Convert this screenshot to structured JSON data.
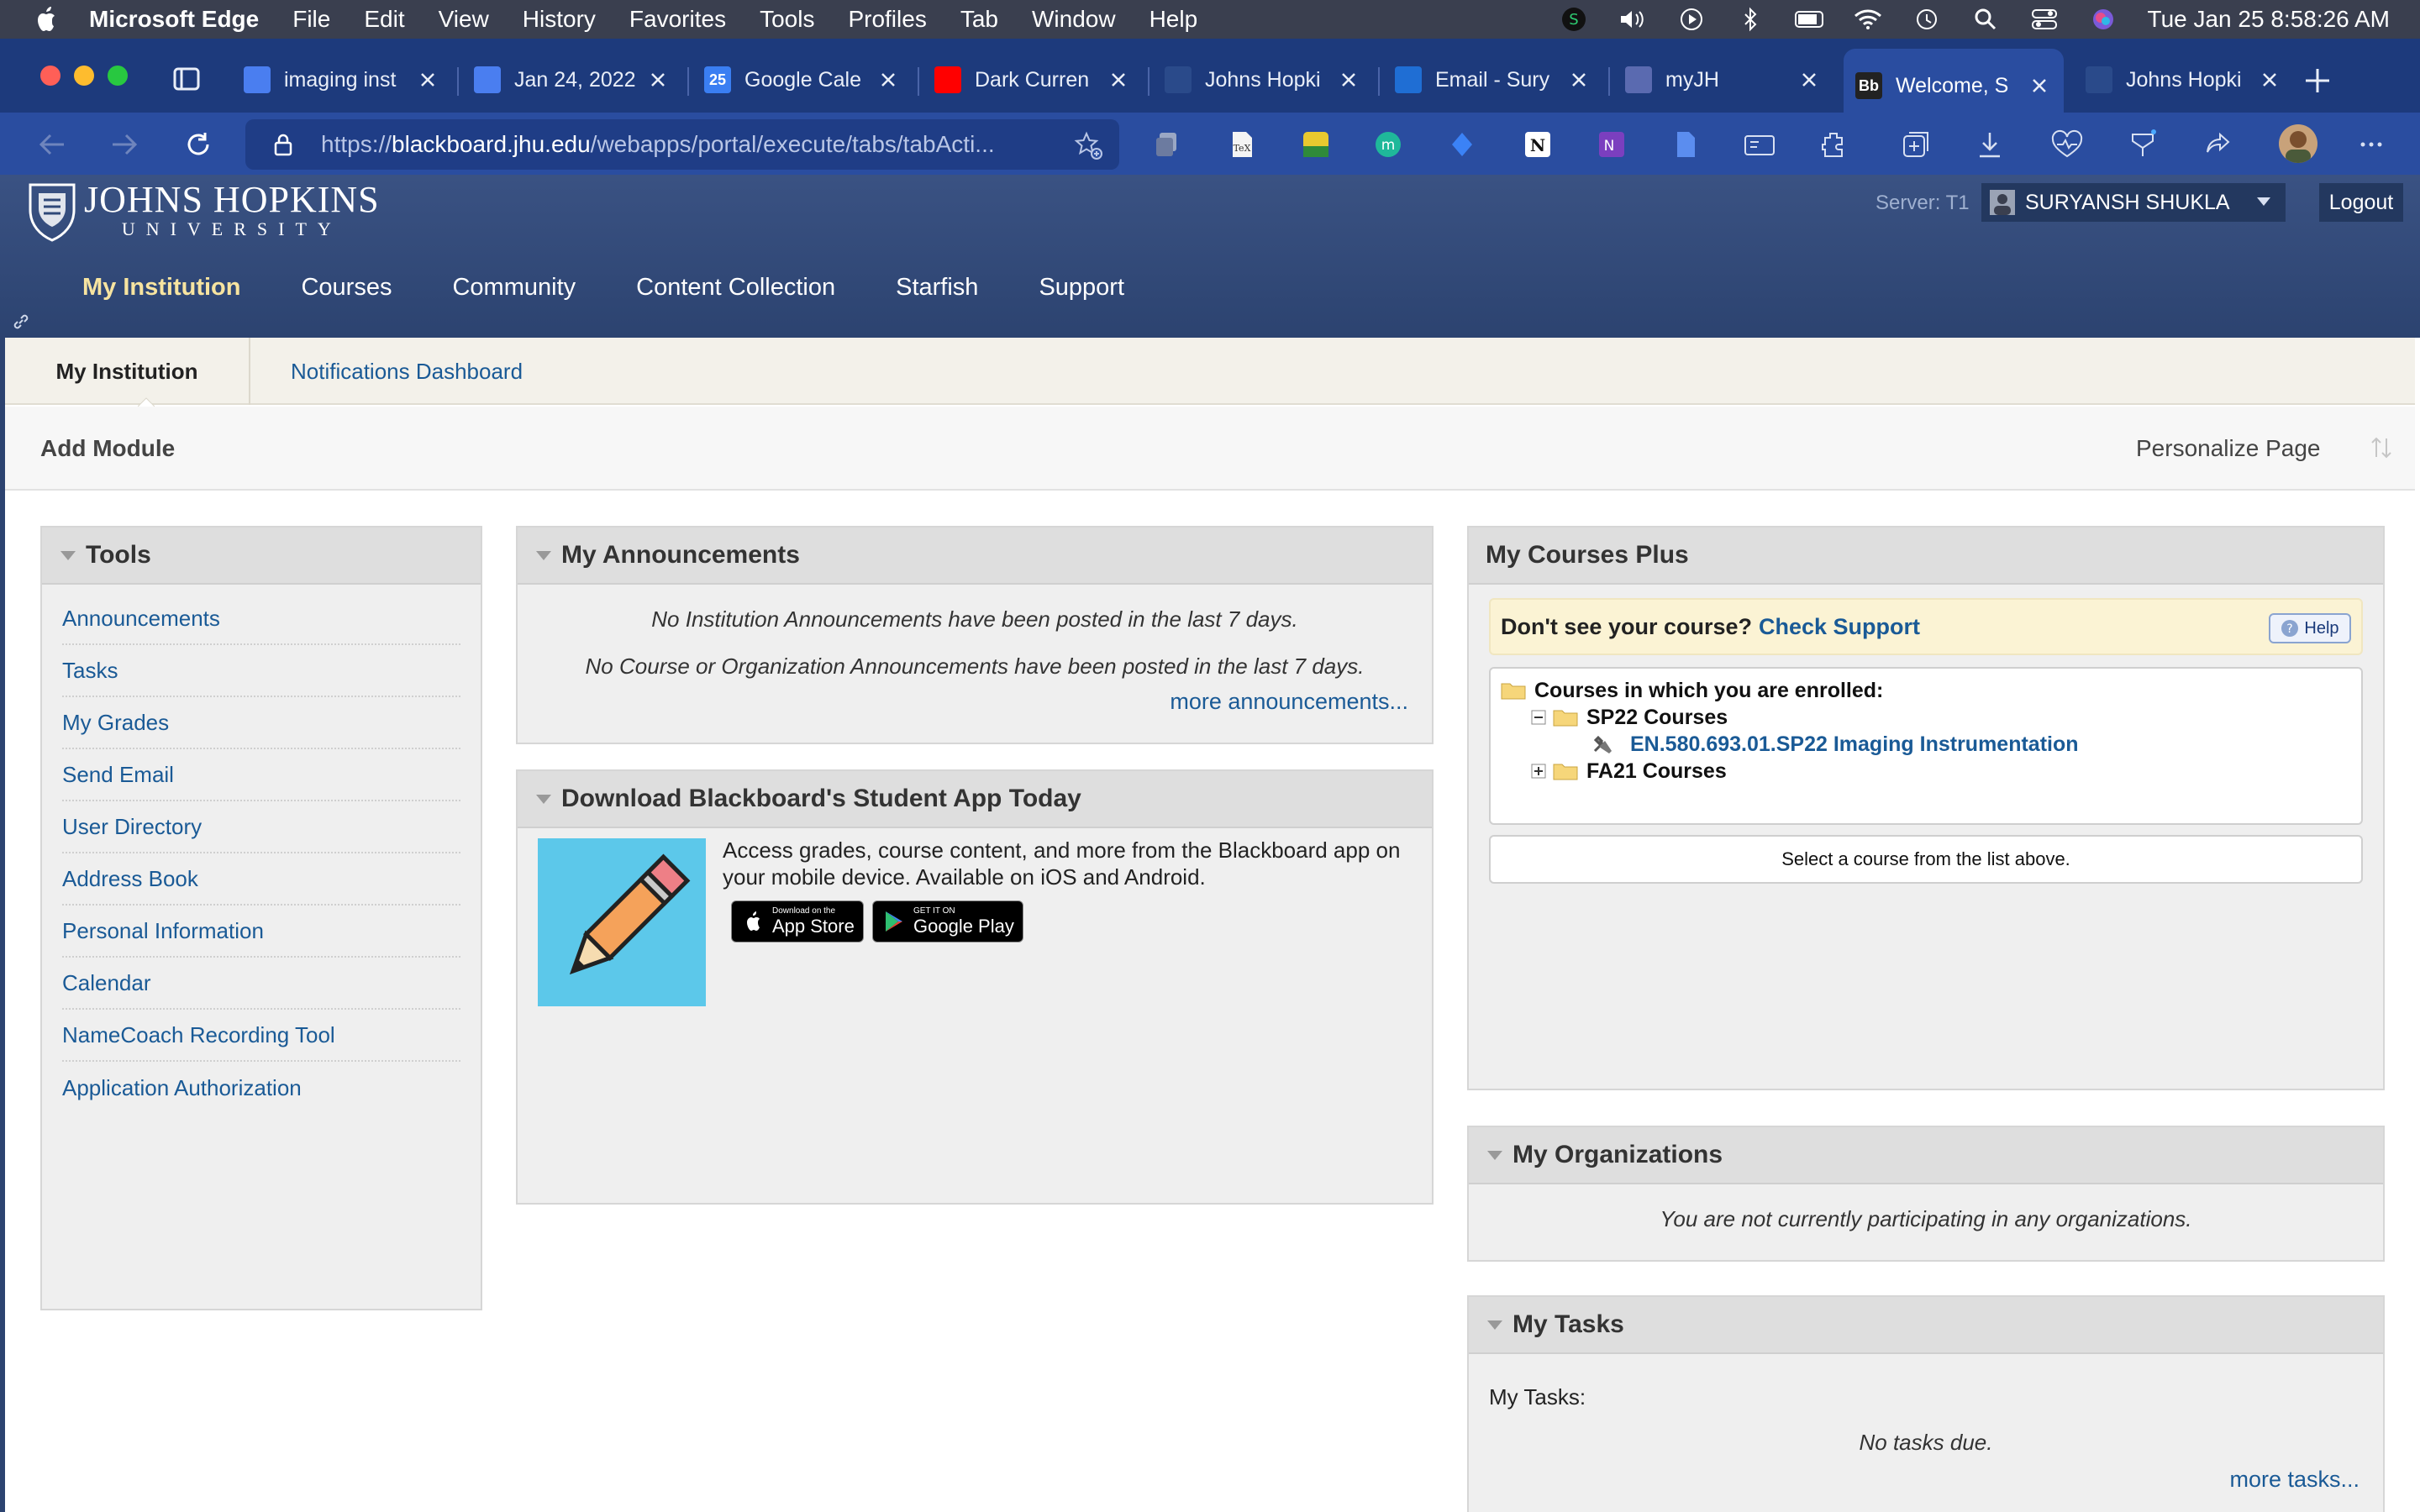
{
  "mac_menubar": {
    "app_name": "Microsoft Edge",
    "menus": [
      "File",
      "Edit",
      "View",
      "History",
      "Favorites",
      "Tools",
      "Profiles",
      "Tab",
      "Window",
      "Help"
    ],
    "clock": "Tue Jan 25  8:58:26 AM"
  },
  "browser": {
    "tabs": [
      {
        "title": "imaging inst",
        "favicon": "google-docs-icon",
        "favicon_color": "#4a7ef0"
      },
      {
        "title": "Jan 24, 2022",
        "favicon": "google-docs-icon",
        "favicon_color": "#4a7ef0"
      },
      {
        "title": "Google Cale",
        "favicon": "google-calendar-icon",
        "favicon_color": "#3a7ef2",
        "favicon_text": "25"
      },
      {
        "title": "Dark Curren",
        "favicon": "youtube-icon",
        "favicon_color": "#ff0000"
      },
      {
        "title": "Johns Hopki",
        "favicon": "jhu-shield-icon",
        "favicon_color": "#2a4a8a"
      },
      {
        "title": "Email - Sury",
        "favicon": "outlook-icon",
        "favicon_color": "#1f6ed4"
      },
      {
        "title": "myJH",
        "favicon": "myjh-icon",
        "favicon_color": "#5a6ab0"
      },
      {
        "title": "Welcome, S",
        "favicon": "blackboard-icon",
        "favicon_color": "#222222",
        "favicon_text": "Bb",
        "active": true
      },
      {
        "title": "Johns Hopki",
        "favicon": "jhu-shield-icon",
        "favicon_color": "#2a4a8a"
      }
    ],
    "url_scheme": "https://",
    "url_host": "blackboard.jhu.edu",
    "url_path": "/webapps/portal/execute/tabs/tabActi..."
  },
  "bb": {
    "logo_name": "JOHNS HOPKINS",
    "logo_sub": "UNIVERSITY",
    "server": "Server: T1",
    "user_name": "SURYANSH SHUKLA",
    "logout": "Logout",
    "nav": [
      "My Institution",
      "Courses",
      "Community",
      "Content Collection",
      "Starfish",
      "Support"
    ],
    "subnav_active": "My Institution",
    "subnav_link": "Notifications Dashboard",
    "add_module": "Add Module",
    "personalize": "Personalize Page"
  },
  "tools": {
    "title": "Tools",
    "items": [
      "Announcements",
      "Tasks",
      "My Grades",
      "Send Email",
      "User Directory",
      "Address Book",
      "Personal Information",
      "Calendar",
      "NameCoach Recording Tool",
      "Application Authorization"
    ]
  },
  "announcements": {
    "title": "My Announcements",
    "msg_institution": "No Institution Announcements have been posted in the last 7 days.",
    "msg_course": "No Course or Organization Announcements have been posted in the last 7 days.",
    "more": "more announcements..."
  },
  "app_promo": {
    "title": "Download Blackboard's Student App Today",
    "text": "Access grades, course content, and more from the Blackboard app on your mobile device. Available on iOS and Android.",
    "appstore_small": "Download on the",
    "appstore_big": "App Store",
    "googleplay_small": "GET IT ON",
    "googleplay_big": "Google Play"
  },
  "courses_plus": {
    "title": "My Courses Plus",
    "notice_q": "Don't see your course?",
    "notice_link": "Check Support",
    "help": "Help",
    "tree_header": "Courses in which you are enrolled:",
    "folder_sp22": "SP22 Courses",
    "course_link": "EN.580.693.01.SP22 Imaging Instrumentation",
    "folder_fa21": "FA21 Courses",
    "select_hint": "Select a course from the list above."
  },
  "organizations": {
    "title": "My Organizations",
    "msg": "You are not currently participating in any organizations."
  },
  "tasks": {
    "title": "My Tasks",
    "label": "My Tasks:",
    "msg": "No tasks due.",
    "more": "more tasks..."
  }
}
